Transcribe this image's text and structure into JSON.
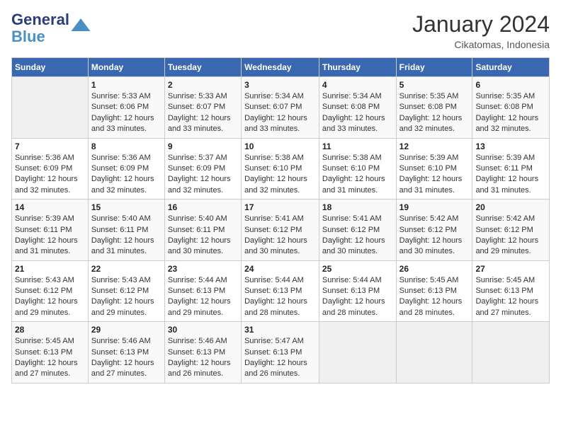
{
  "logo": {
    "line1": "General",
    "line2": "Blue"
  },
  "title": "January 2024",
  "location": "Cikatomas, Indonesia",
  "days_header": [
    "Sunday",
    "Monday",
    "Tuesday",
    "Wednesday",
    "Thursday",
    "Friday",
    "Saturday"
  ],
  "weeks": [
    [
      {
        "day": "",
        "sunrise": "",
        "sunset": "",
        "daylight": ""
      },
      {
        "day": "1",
        "sunrise": "Sunrise: 5:33 AM",
        "sunset": "Sunset: 6:06 PM",
        "daylight": "Daylight: 12 hours and 33 minutes."
      },
      {
        "day": "2",
        "sunrise": "Sunrise: 5:33 AM",
        "sunset": "Sunset: 6:07 PM",
        "daylight": "Daylight: 12 hours and 33 minutes."
      },
      {
        "day": "3",
        "sunrise": "Sunrise: 5:34 AM",
        "sunset": "Sunset: 6:07 PM",
        "daylight": "Daylight: 12 hours and 33 minutes."
      },
      {
        "day": "4",
        "sunrise": "Sunrise: 5:34 AM",
        "sunset": "Sunset: 6:08 PM",
        "daylight": "Daylight: 12 hours and 33 minutes."
      },
      {
        "day": "5",
        "sunrise": "Sunrise: 5:35 AM",
        "sunset": "Sunset: 6:08 PM",
        "daylight": "Daylight: 12 hours and 32 minutes."
      },
      {
        "day": "6",
        "sunrise": "Sunrise: 5:35 AM",
        "sunset": "Sunset: 6:08 PM",
        "daylight": "Daylight: 12 hours and 32 minutes."
      }
    ],
    [
      {
        "day": "7",
        "sunrise": "Sunrise: 5:36 AM",
        "sunset": "Sunset: 6:09 PM",
        "daylight": "Daylight: 12 hours and 32 minutes."
      },
      {
        "day": "8",
        "sunrise": "Sunrise: 5:36 AM",
        "sunset": "Sunset: 6:09 PM",
        "daylight": "Daylight: 12 hours and 32 minutes."
      },
      {
        "day": "9",
        "sunrise": "Sunrise: 5:37 AM",
        "sunset": "Sunset: 6:09 PM",
        "daylight": "Daylight: 12 hours and 32 minutes."
      },
      {
        "day": "10",
        "sunrise": "Sunrise: 5:38 AM",
        "sunset": "Sunset: 6:10 PM",
        "daylight": "Daylight: 12 hours and 32 minutes."
      },
      {
        "day": "11",
        "sunrise": "Sunrise: 5:38 AM",
        "sunset": "Sunset: 6:10 PM",
        "daylight": "Daylight: 12 hours and 31 minutes."
      },
      {
        "day": "12",
        "sunrise": "Sunrise: 5:39 AM",
        "sunset": "Sunset: 6:10 PM",
        "daylight": "Daylight: 12 hours and 31 minutes."
      },
      {
        "day": "13",
        "sunrise": "Sunrise: 5:39 AM",
        "sunset": "Sunset: 6:11 PM",
        "daylight": "Daylight: 12 hours and 31 minutes."
      }
    ],
    [
      {
        "day": "14",
        "sunrise": "Sunrise: 5:39 AM",
        "sunset": "Sunset: 6:11 PM",
        "daylight": "Daylight: 12 hours and 31 minutes."
      },
      {
        "day": "15",
        "sunrise": "Sunrise: 5:40 AM",
        "sunset": "Sunset: 6:11 PM",
        "daylight": "Daylight: 12 hours and 31 minutes."
      },
      {
        "day": "16",
        "sunrise": "Sunrise: 5:40 AM",
        "sunset": "Sunset: 6:11 PM",
        "daylight": "Daylight: 12 hours and 30 minutes."
      },
      {
        "day": "17",
        "sunrise": "Sunrise: 5:41 AM",
        "sunset": "Sunset: 6:12 PM",
        "daylight": "Daylight: 12 hours and 30 minutes."
      },
      {
        "day": "18",
        "sunrise": "Sunrise: 5:41 AM",
        "sunset": "Sunset: 6:12 PM",
        "daylight": "Daylight: 12 hours and 30 minutes."
      },
      {
        "day": "19",
        "sunrise": "Sunrise: 5:42 AM",
        "sunset": "Sunset: 6:12 PM",
        "daylight": "Daylight: 12 hours and 30 minutes."
      },
      {
        "day": "20",
        "sunrise": "Sunrise: 5:42 AM",
        "sunset": "Sunset: 6:12 PM",
        "daylight": "Daylight: 12 hours and 29 minutes."
      }
    ],
    [
      {
        "day": "21",
        "sunrise": "Sunrise: 5:43 AM",
        "sunset": "Sunset: 6:12 PM",
        "daylight": "Daylight: 12 hours and 29 minutes."
      },
      {
        "day": "22",
        "sunrise": "Sunrise: 5:43 AM",
        "sunset": "Sunset: 6:12 PM",
        "daylight": "Daylight: 12 hours and 29 minutes."
      },
      {
        "day": "23",
        "sunrise": "Sunrise: 5:44 AM",
        "sunset": "Sunset: 6:13 PM",
        "daylight": "Daylight: 12 hours and 29 minutes."
      },
      {
        "day": "24",
        "sunrise": "Sunrise: 5:44 AM",
        "sunset": "Sunset: 6:13 PM",
        "daylight": "Daylight: 12 hours and 28 minutes."
      },
      {
        "day": "25",
        "sunrise": "Sunrise: 5:44 AM",
        "sunset": "Sunset: 6:13 PM",
        "daylight": "Daylight: 12 hours and 28 minutes."
      },
      {
        "day": "26",
        "sunrise": "Sunrise: 5:45 AM",
        "sunset": "Sunset: 6:13 PM",
        "daylight": "Daylight: 12 hours and 28 minutes."
      },
      {
        "day": "27",
        "sunrise": "Sunrise: 5:45 AM",
        "sunset": "Sunset: 6:13 PM",
        "daylight": "Daylight: 12 hours and 27 minutes."
      }
    ],
    [
      {
        "day": "28",
        "sunrise": "Sunrise: 5:45 AM",
        "sunset": "Sunset: 6:13 PM",
        "daylight": "Daylight: 12 hours and 27 minutes."
      },
      {
        "day": "29",
        "sunrise": "Sunrise: 5:46 AM",
        "sunset": "Sunset: 6:13 PM",
        "daylight": "Daylight: 12 hours and 27 minutes."
      },
      {
        "day": "30",
        "sunrise": "Sunrise: 5:46 AM",
        "sunset": "Sunset: 6:13 PM",
        "daylight": "Daylight: 12 hours and 26 minutes."
      },
      {
        "day": "31",
        "sunrise": "Sunrise: 5:47 AM",
        "sunset": "Sunset: 6:13 PM",
        "daylight": "Daylight: 12 hours and 26 minutes."
      },
      {
        "day": "",
        "sunrise": "",
        "sunset": "",
        "daylight": ""
      },
      {
        "day": "",
        "sunrise": "",
        "sunset": "",
        "daylight": ""
      },
      {
        "day": "",
        "sunrise": "",
        "sunset": "",
        "daylight": ""
      }
    ]
  ]
}
